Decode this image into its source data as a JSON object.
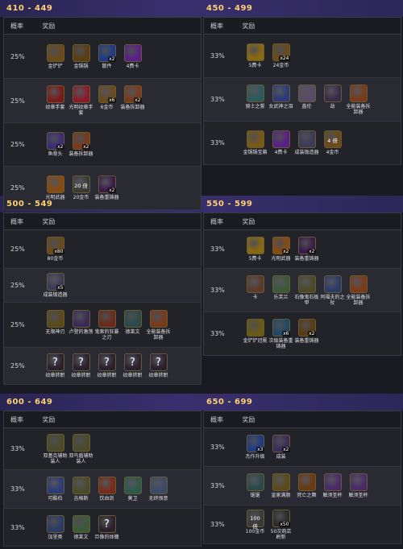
{
  "colors": {
    "page_bg": "#1a1b22",
    "header_strip": "#3a2f6e",
    "range_title": "#ffd070"
  },
  "tables": [
    {
      "title": "410 - 449",
      "header": {
        "rate": "概率",
        "reward": "奖励"
      },
      "rows": [
        {
          "rate": "25%",
          "items": [
            {
              "icon": "golden-shovel-icon",
              "color": "#6a4a1a",
              "label": "金铲铲"
            },
            {
              "icon": "golden-spatula-icon",
              "color": "#5a3e12",
              "label": "金锅锅"
            },
            {
              "icon": "component-orb-icon",
              "color": "#1c3a8a",
              "qty": "x2",
              "label": "散件"
            },
            {
              "icon": "purple-orb-icon",
              "color": "#5a1e8a",
              "label": "4费卡"
            }
          ]
        },
        {
          "rate": "25%",
          "items": [
            {
              "icon": "emblem-gloves-icon",
              "color": "#7a1a1a",
              "label": "纹章手套"
            },
            {
              "icon": "radiant-gloves-icon",
              "color": "#8a1a2a",
              "label": "光明纹章手套"
            },
            {
              "icon": "gold-bag-icon",
              "color": "#6a4a1a",
              "qty": "x6",
              "label": "6金币"
            },
            {
              "icon": "item-remover-icon",
              "color": "#7a3a1a",
              "qty": "x2",
              "label": "装备拆卸器"
            }
          ]
        },
        {
          "rate": "25%",
          "items": [
            {
              "icon": "fish-sword-icon",
              "color": "#3a2a7a",
              "qty": "x2",
              "label": "鱼骨头"
            },
            {
              "icon": "item-remover-icon",
              "color": "#7a3a1a",
              "qty": "x2",
              "label": "装备拆卸器"
            }
          ]
        },
        {
          "rate": "25%",
          "items": [
            {
              "icon": "radiant-armory-icon",
              "color": "#8a4a10",
              "label": "光明武器"
            },
            {
              "icon": "gold-coins-icon",
              "color": "#3a3a3a",
              "cn": "20 倍",
              "label": "20金币"
            },
            {
              "icon": "item-chest-icon",
              "color": "#3a1a4a",
              "qty": "x2",
              "label": "装备重铸器"
            }
          ]
        }
      ]
    },
    {
      "title": "450 - 499",
      "header": {
        "rate": "概率",
        "reward": "奖励"
      },
      "rows": [
        {
          "rate": "33%",
          "items": [
            {
              "icon": "five-cost-card-icon",
              "color": "#8a6a10",
              "label": "5费卡"
            },
            {
              "icon": "gold-bag-icon",
              "color": "#6a4a1a",
              "qty": "x24",
              "label": "24金币"
            }
          ]
        },
        {
          "rate": "33%",
          "items": [
            {
              "icon": "champion-icon",
              "color": "#2a5a5a",
              "label": "骑士之誓"
            },
            {
              "icon": "champion-icon",
              "color": "#2a3a7a",
              "label": "女武神之泪"
            },
            {
              "icon": "champion-icon",
              "color": "#5a4a6a",
              "label": "盖伦"
            },
            {
              "icon": "champion-icon",
              "color": "#3a2a4a",
              "label": "劫"
            },
            {
              "icon": "item-remover-icon",
              "color": "#7a3a1a",
              "label": "全能装备拆卸器"
            }
          ]
        },
        {
          "rate": "33%",
          "items": [
            {
              "icon": "golden-spatula-icon",
              "color": "#7a5a14",
              "label": "金锅锅宝箱"
            },
            {
              "icon": "purple-orb-icon",
              "color": "#5a1e8a",
              "label": "4费卡"
            },
            {
              "icon": "finished-item-icon",
              "color": "#3a3a5a",
              "label": "成装锻造器"
            },
            {
              "icon": "gold-bag-icon",
              "color": "#6a4a1a",
              "cn": "4 倍",
              "label": "4金币"
            }
          ]
        }
      ]
    },
    {
      "title": "500 - 549",
      "header": {
        "rate": "概率",
        "reward": "奖励"
      },
      "rows": [
        {
          "rate": "25%",
          "items": [
            {
              "icon": "gold-bag-icon",
              "color": "#6a4a1a",
              "qty": "x80",
              "label": "80金币"
            }
          ]
        },
        {
          "rate": "25%",
          "items": [
            {
              "icon": "finished-item-icon",
              "color": "#3a3a5a",
              "qty": "x5",
              "label": "成装锻造器"
            }
          ]
        },
        {
          "rate": "25%",
          "items": [
            {
              "icon": "infinity-edge-icon",
              "color": "#5a4a1a",
              "label": "无限神刃"
            },
            {
              "icon": "rabadon-icon",
              "color": "#3a2a5a",
              "label": "卢登的激荡"
            },
            {
              "icon": "guinsoo-icon",
              "color": "#6a2a1a",
              "label": "鬼索的狂暴之刃"
            },
            {
              "icon": "emblem-icon",
              "color": "#2a4a4a",
              "label": "德莱文"
            },
            {
              "icon": "item-remover-icon",
              "color": "#7a3a1a",
              "label": "全能装备拆卸器"
            }
          ]
        },
        {
          "rate": "25%",
          "items": [
            {
              "icon": "mystery-icon",
              "color": "#2a2030",
              "cn": "?",
              "label": "纹章转职"
            },
            {
              "icon": "mystery-icon",
              "color": "#2a2030",
              "cn": "?",
              "label": "纹章转职"
            },
            {
              "icon": "mystery-icon",
              "color": "#2a2030",
              "cn": "?",
              "label": "纹章转职"
            },
            {
              "icon": "mystery-icon",
              "color": "#2a2030",
              "cn": "?",
              "label": "纹章转职"
            },
            {
              "icon": "mystery-icon",
              "color": "#2a2030",
              "cn": "?",
              "label": "纹章转职"
            }
          ]
        }
      ]
    },
    {
      "title": "550 - 599",
      "header": {
        "rate": "概率",
        "reward": "奖励"
      },
      "rows": [
        {
          "rate": "33%",
          "items": [
            {
              "icon": "five-cost-card-icon",
              "color": "#8a6a10",
              "label": "5费卡"
            },
            {
              "icon": "radiant-armory-icon",
              "color": "#8a4a10",
              "qty": "x2",
              "label": "光明武器"
            },
            {
              "icon": "item-chest-icon",
              "color": "#3a1a4a",
              "qty": "x2",
              "label": "装备重铸器"
            }
          ]
        },
        {
          "rate": "33%",
          "items": [
            {
              "icon": "champion-icon",
              "color": "#5a3a2a",
              "label": "卡"
            },
            {
              "icon": "champion-icon",
              "color": "#3a5a3a",
              "label": "乐芙兰"
            },
            {
              "icon": "champion-icon",
              "color": "#4a4a2a",
              "label": "石像鬼石板甲"
            },
            {
              "icon": "champion-icon",
              "color": "#2a3a6a",
              "label": "阿福夫的之杖"
            },
            {
              "icon": "item-remover-icon",
              "color": "#7a3a1a",
              "label": "全能装备拆卸器"
            }
          ]
        },
        {
          "rate": "33%",
          "items": [
            {
              "icon": "golden-spatula-icon",
              "color": "#6a5a14",
              "label": "金铲铲冠冕"
            },
            {
              "icon": "reforger-icon",
              "color": "#1a4a6a",
              "qty": "x6",
              "label": "次级装备重铸器"
            },
            {
              "icon": "item-chest-icon",
              "color": "#5a3a10",
              "qty": "x2",
              "label": "装备重铸器"
            }
          ]
        }
      ]
    },
    {
      "title": "600 - 649",
      "header": {
        "rate": "概率",
        "reward": "奖励"
      },
      "rows": [
        {
          "rate": "33%",
          "items": [
            {
              "icon": "champion-icon",
              "color": "#4a4a2a",
              "label": "双基克辅助装人"
            },
            {
              "icon": "champion-icon",
              "color": "#4a4a2a",
              "label": "双鸟盾辅助装人"
            }
          ]
        },
        {
          "rate": "33%",
          "items": [
            {
              "icon": "champion-icon",
              "color": "#2a3a7a",
              "label": "可酷伯"
            },
            {
              "icon": "champion-icon",
              "color": "#4a4a2a",
              "label": "吉格斯"
            },
            {
              "icon": "champion-icon",
              "color": "#7a2a1a",
              "label": "饮血剑"
            },
            {
              "icon": "champion-icon",
              "color": "#2a5a4a",
              "label": "莫卫"
            },
            {
              "icon": "champion-icon",
              "color": "#3a4a6a",
              "label": "无终恨意"
            }
          ]
        },
        {
          "rate": "33%",
          "items": [
            {
              "icon": "champion-icon",
              "color": "#2a3a6a",
              "label": "加里奥"
            },
            {
              "icon": "champion-icon",
              "color": "#3a5a3a",
              "label": "德莱文"
            },
            {
              "icon": "mystery-icon",
              "color": "#2a2030",
              "cn": "?",
              "label": "巨像的体魄"
            }
          ]
        }
      ]
    },
    {
      "title": "650 - 699",
      "header": {
        "rate": "概率",
        "reward": "奖励"
      },
      "rows": [
        {
          "rate": "33%",
          "items": [
            {
              "icon": "upgrade-orb-icon",
              "color": "#1a3a8a",
              "qty": "x3",
              "label": "杰作升级"
            },
            {
              "icon": "finished-item-icon",
              "color": "#3a2a5a",
              "qty": "x2",
              "label": "成装"
            }
          ]
        },
        {
          "rate": "33%",
          "items": [
            {
              "icon": "champion-icon",
              "color": "#2a4a4a",
              "label": "锯锯"
            },
            {
              "icon": "champion-icon",
              "color": "#5a4a1a",
              "label": "皇家满肠"
            },
            {
              "icon": "champion-icon",
              "color": "#6a3a10",
              "label": "死亡之舞"
            },
            {
              "icon": "champion-icon",
              "color": "#4a2a6a",
              "label": "触须圣杯"
            },
            {
              "icon": "champion-icon",
              "color": "#4a2a6a",
              "label": "触须圣杯"
            }
          ]
        },
        {
          "rate": "33%",
          "items": [
            {
              "icon": "gold-coins-icon",
              "color": "#3a3a3a",
              "cn": "100 倍",
              "label": "100金币"
            },
            {
              "icon": "shop-reroll-icon",
              "color": "#2a2a2a",
              "qty": "x50",
              "label": "50次商店刷新"
            }
          ]
        }
      ]
    }
  ]
}
